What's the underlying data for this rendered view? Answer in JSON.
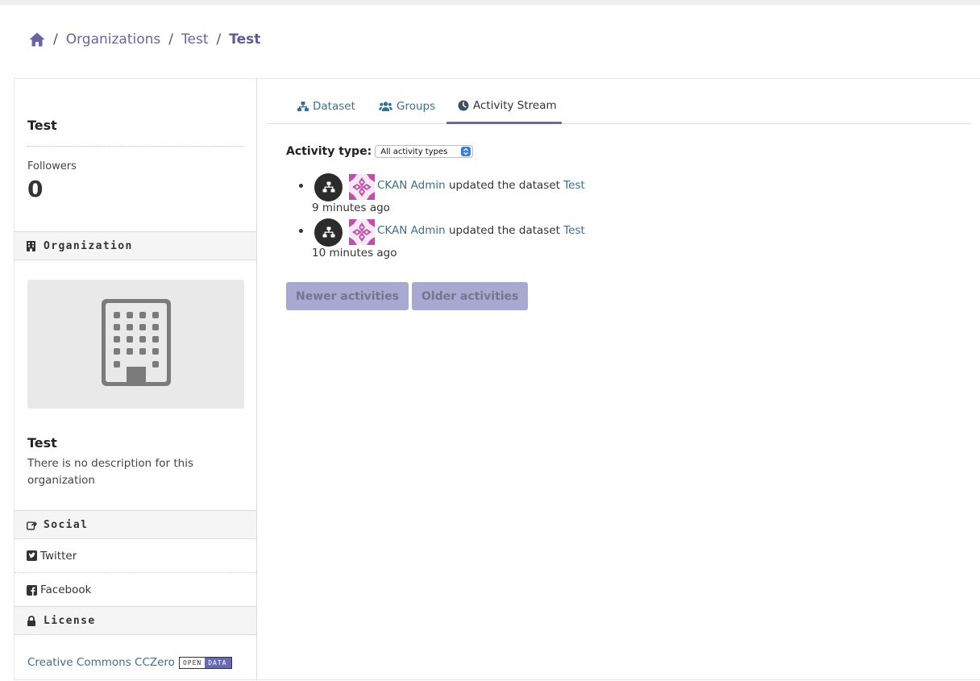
{
  "breadcrumb": {
    "home_icon": "home-icon",
    "items": [
      "Organizations",
      "Test",
      "Test"
    ]
  },
  "sidebar": {
    "title": "Test",
    "followers_label": "Followers",
    "followers_count": "0",
    "organization_heading": "Organization",
    "org_name": "Test",
    "org_description": "There is no description for this organization",
    "social_heading": "Social",
    "social_items": [
      "Twitter",
      "Facebook"
    ],
    "license_heading": "License",
    "license_link": "Creative Commons CCZero",
    "open_data_badge": [
      "OPEN",
      "DATA"
    ]
  },
  "tabs": [
    "Dataset",
    "Groups",
    "Activity Stream"
  ],
  "active_tab": "Activity Stream",
  "activity": {
    "type_label": "Activity type:",
    "type_value": "All activity types",
    "items": [
      {
        "user": "CKAN Admin",
        "action": "updated the dataset",
        "dataset": "Test",
        "time": "9 minutes ago"
      },
      {
        "user": "CKAN Admin",
        "action": "updated the dataset",
        "dataset": "Test",
        "time": "10 minutes ago"
      }
    ]
  },
  "pager": {
    "newer": "Newer activities",
    "older": "Older activities"
  },
  "colors": {
    "accent": "#6565a6",
    "link": "#3c6f8f",
    "button_bg": "#a8a8d0"
  }
}
